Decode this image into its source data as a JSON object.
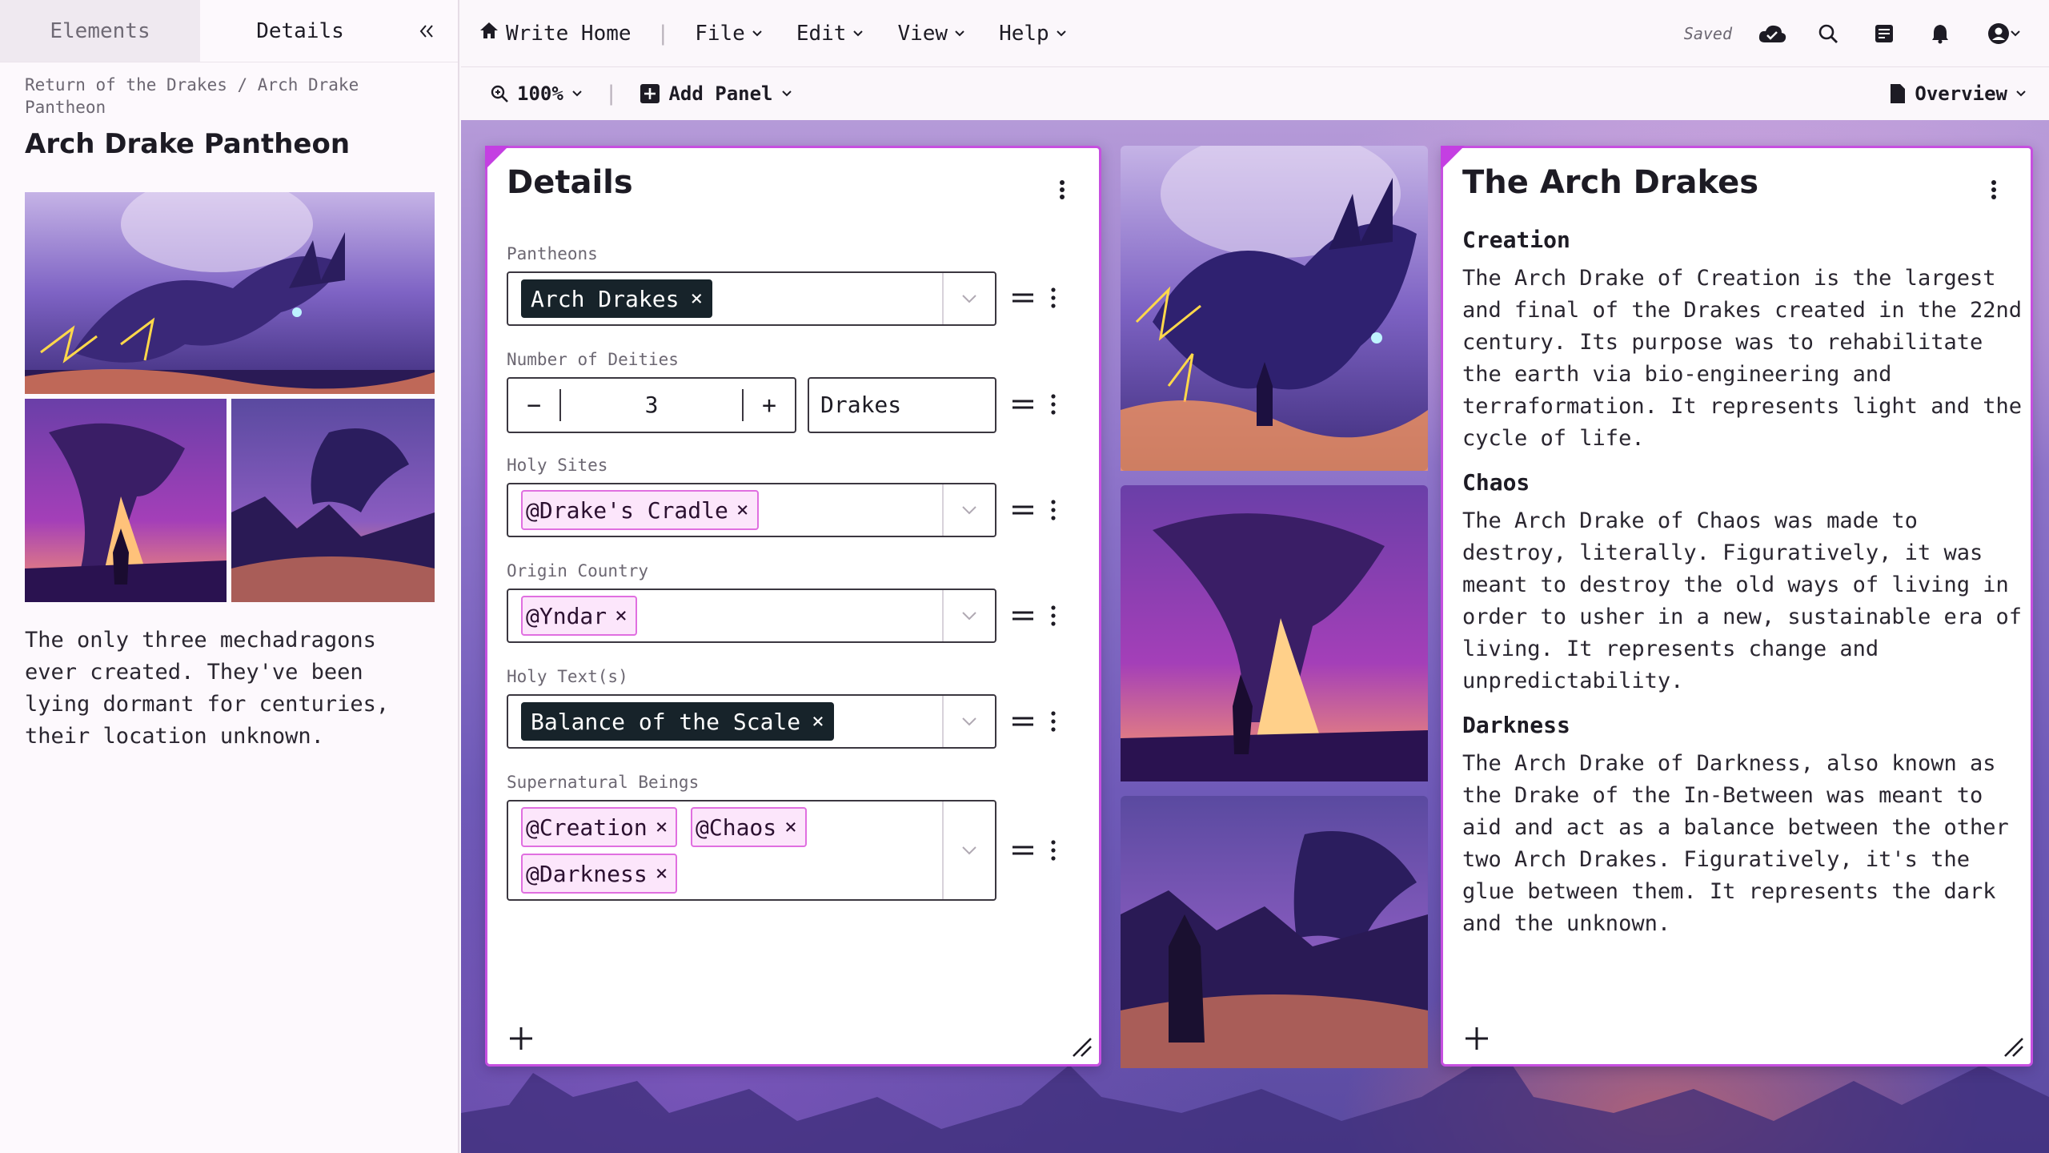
{
  "sidebar": {
    "tabs": [
      {
        "label": "Elements"
      },
      {
        "label": "Details"
      }
    ],
    "breadcrumb": "Return of the Drakes / Arch Drake Pantheon",
    "title": "Arch Drake Pantheon",
    "description": "The only three mechadragons ever created. They've been lying dormant for centuries, their location unknown."
  },
  "topbar": {
    "home": "Write Home",
    "menus": [
      "File",
      "Edit",
      "View",
      "Help"
    ],
    "saved": "Saved"
  },
  "toolbar": {
    "zoom": "100%",
    "add_panel": "Add Panel",
    "overview": "Overview"
  },
  "details_panel": {
    "title": "Details",
    "fields": {
      "pantheons": {
        "label": "Pantheons",
        "chips": [
          "Arch Drakes"
        ]
      },
      "deities": {
        "label": "Number of Deities",
        "value": "3",
        "unit": "Drakes"
      },
      "holy_sites": {
        "label": "Holy Sites",
        "chips": [
          "Drake's Cradle"
        ]
      },
      "origin": {
        "label": "Origin Country",
        "chips": [
          "Yndar"
        ]
      },
      "holy_texts": {
        "label": "Holy Text(s)",
        "chips": [
          "Balance of the Scale"
        ]
      },
      "beings": {
        "label": "Supernatural Beings",
        "chips": [
          "Creation",
          "Chaos",
          "Darkness"
        ]
      }
    }
  },
  "article_panel": {
    "title": "The Arch Drakes",
    "sections": [
      {
        "heading": "Creation",
        "body": "The Arch Drake of Creation is the largest and final of the Drakes created in the 22nd century. Its purpose was to rehabilitate the earth via bio-engineering and terraformation. It represents light and the cycle of life."
      },
      {
        "heading": "Chaos",
        "body": "The Arch Drake of Chaos was made to destroy, literally. Figuratively, it was meant to destroy the old ways of living in order to usher in a new, sustainable era of living. It represents change and unpredictability."
      },
      {
        "heading": "Darkness",
        "body": "The Arch Drake of Darkness, also known as the Drake of the In-Between was meant to aid and act as a balance between the other two Arch Drakes. Figuratively, it's the glue between them. It represents the dark and the unknown."
      }
    ]
  },
  "colors": {
    "accent": "#c64fe0",
    "chip_dark": "#17232a",
    "chip_link_bg": "#fce6fb"
  }
}
